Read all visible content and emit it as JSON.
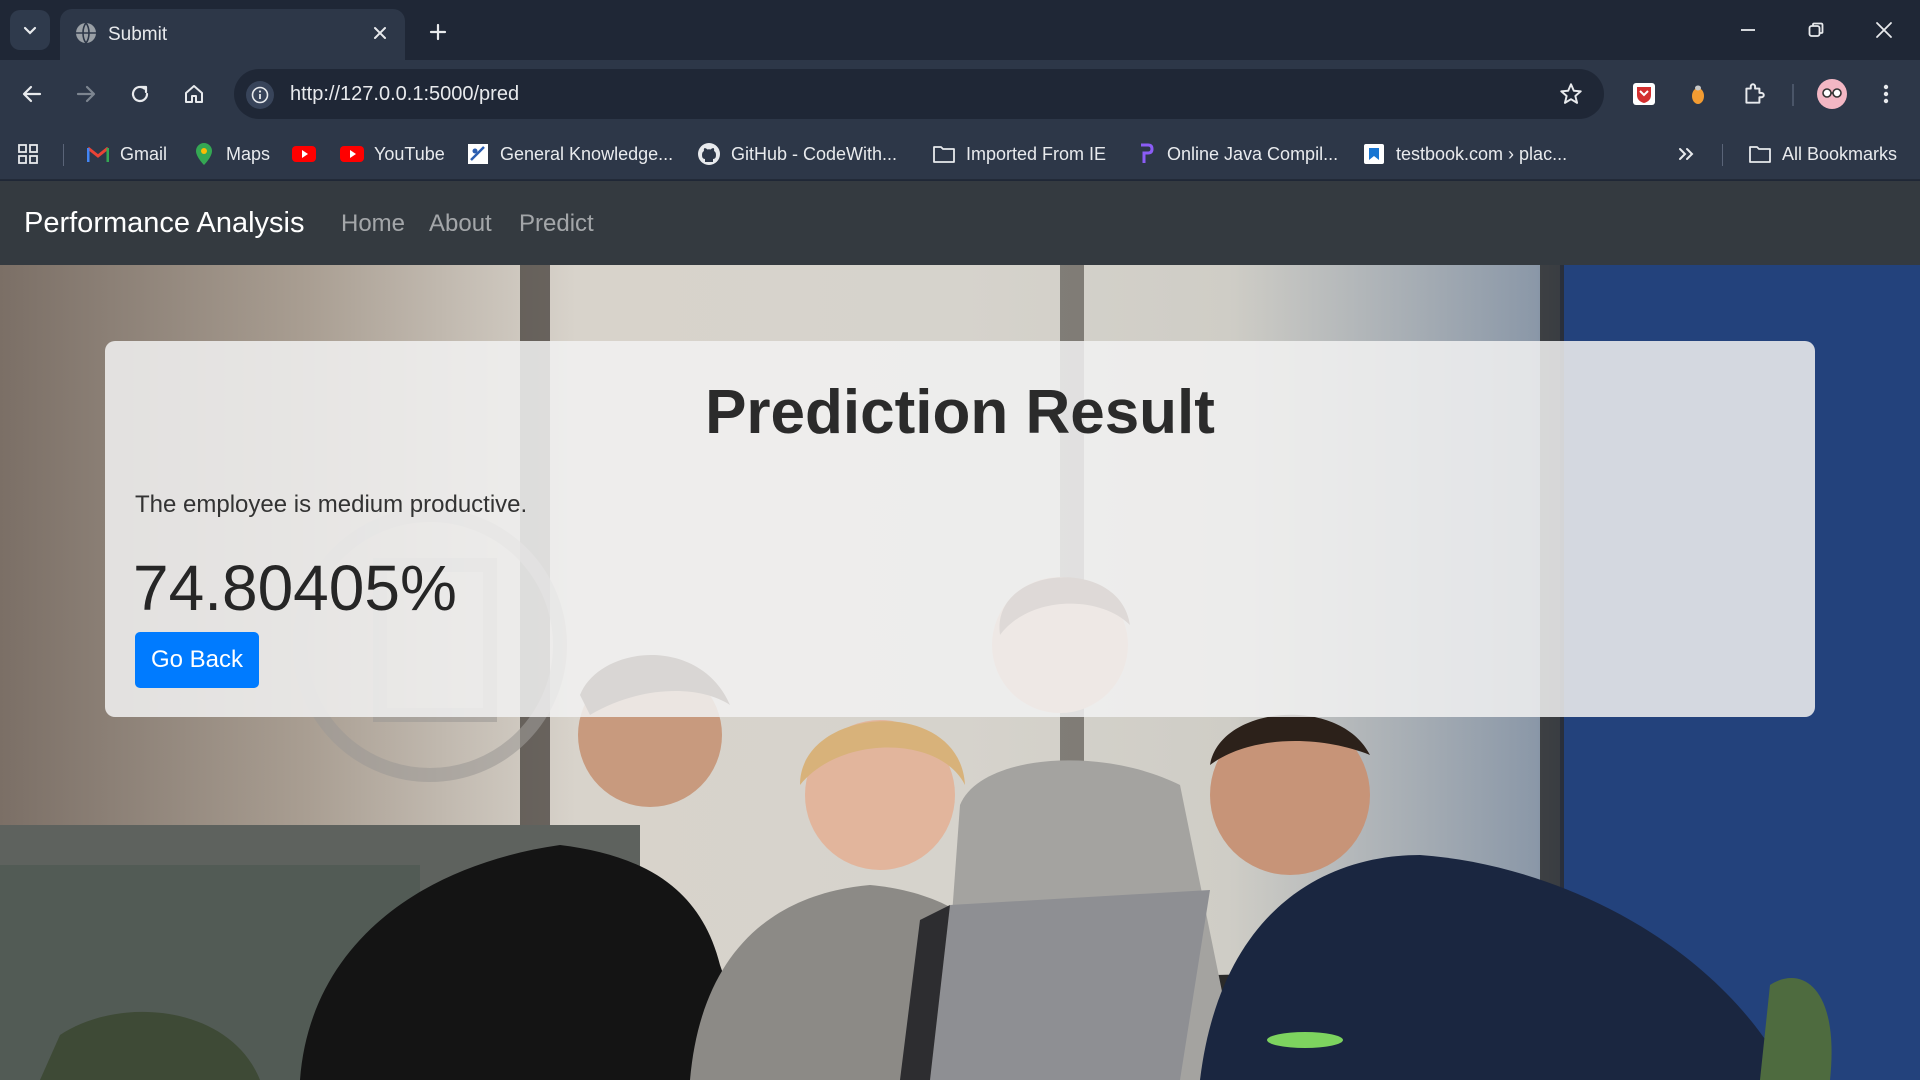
{
  "browser": {
    "tab_title": "Submit",
    "url": "http://127.0.0.1:5000/pred"
  },
  "bookmarks": [
    {
      "label": "Gmail",
      "icon": "gmail-icon"
    },
    {
      "label": "Maps",
      "icon": "maps-icon"
    },
    {
      "label": "",
      "icon": "youtube-icon"
    },
    {
      "label": "YouTube",
      "icon": "youtube-icon"
    },
    {
      "label": "General Knowledge...",
      "icon": "bookmark-favicon"
    },
    {
      "label": "GitHub - CodeWith...",
      "icon": "github-icon"
    },
    {
      "label": "Imported From IE",
      "icon": "folder-icon"
    },
    {
      "label": "Online Java Compil...",
      "icon": "bookmark-favicon"
    },
    {
      "label": "testbook.com › plac...",
      "icon": "bookmark-favicon"
    }
  ],
  "all_bookmarks_label": "All Bookmarks",
  "navbar": {
    "brand": "Performance Analysis",
    "links": [
      "Home",
      "About",
      "Predict"
    ]
  },
  "result": {
    "title": "Prediction Result",
    "message": "The employee is medium productive.",
    "percentage": "74.80405%",
    "button_label": "Go Back"
  },
  "colors": {
    "navbar_bg": "#343a40",
    "button_primary": "#007bff",
    "chrome_bg": "#1f2736"
  }
}
